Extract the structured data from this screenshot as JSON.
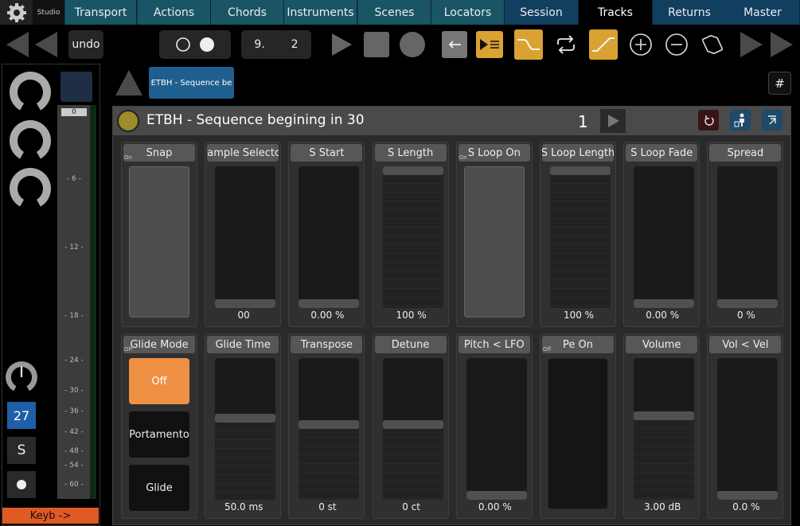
{
  "nav": {
    "studio_label": "Studio",
    "tabs": [
      "Transport",
      "Actions",
      "Chords",
      "Instruments",
      "Scenes",
      "Locators",
      "Session",
      "Tracks",
      "Returns",
      "Master"
    ],
    "active": "Tracks"
  },
  "toolbar": {
    "undo_label": "undo",
    "position_bar": "9.",
    "position_beat": "2"
  },
  "breadcrumb": {
    "clip_label": "ETBH - Sequence be",
    "hash_label": "#"
  },
  "left": {
    "track_number": "27",
    "solo_label": "S",
    "keyb_label": "Keyb ->",
    "meter_ticks": [
      "0",
      "- 6 -",
      "- 12 -",
      "- 18 -",
      "- 24 -",
      "- 30 -",
      "- 36 -",
      "- 42 -",
      "- 48 -",
      "- 54 -",
      "- 60 -"
    ]
  },
  "device": {
    "title": "ETBH - Sequence begining in 30",
    "bank_number": "1"
  },
  "params_row1": [
    {
      "name": "Snap",
      "kind": "toggle",
      "state_label": "On"
    },
    {
      "name": "Sample Selector",
      "kind": "slider",
      "level": 0.0,
      "value": "00"
    },
    {
      "name": "S Start",
      "kind": "slider",
      "level": 0.0,
      "value": "0.00 %"
    },
    {
      "name": "S Length",
      "kind": "slider",
      "level": 1.0,
      "value": "100 %"
    },
    {
      "name": "S Loop On",
      "kind": "toggle",
      "state_label": "On"
    },
    {
      "name": "S Loop Length",
      "kind": "slider",
      "level": 1.0,
      "value": "100 %"
    },
    {
      "name": "S Loop Fade",
      "kind": "slider",
      "level": 0.0,
      "value": "0.00 %"
    },
    {
      "name": "Spread",
      "kind": "slider",
      "level": 0.0,
      "value": "0 %"
    }
  ],
  "params_row2": [
    {
      "name": "Glide Mode",
      "kind": "options",
      "state_label": "Off",
      "options": [
        "Off",
        "Portamento",
        "Glide"
      ],
      "selected": 0
    },
    {
      "name": "Glide Time",
      "kind": "slider",
      "level": 0.58,
      "value": "50.0 ms"
    },
    {
      "name": "Transpose",
      "kind": "slider",
      "level": 0.53,
      "value": "0 st"
    },
    {
      "name": "Detune",
      "kind": "slider",
      "level": 0.53,
      "value": "0 ct"
    },
    {
      "name": "Pitch < LFO",
      "kind": "slider",
      "level": 0.0,
      "value": "0.00 %"
    },
    {
      "name": "Pe On",
      "kind": "toggle-off",
      "state_label": "Off",
      "value": ""
    },
    {
      "name": "Volume",
      "kind": "slider",
      "level": 0.6,
      "value": "3.00 dB"
    },
    {
      "name": "Vol < Vel",
      "kind": "slider",
      "level": 0.0,
      "value": "0.0 %"
    }
  ],
  "colors": {
    "accent_gold": "#d9a233",
    "orange": "#e05a24",
    "selected_option": "#ee9144",
    "track_blue": "#1f5fa8",
    "nav_blue": "#0f3a55"
  }
}
